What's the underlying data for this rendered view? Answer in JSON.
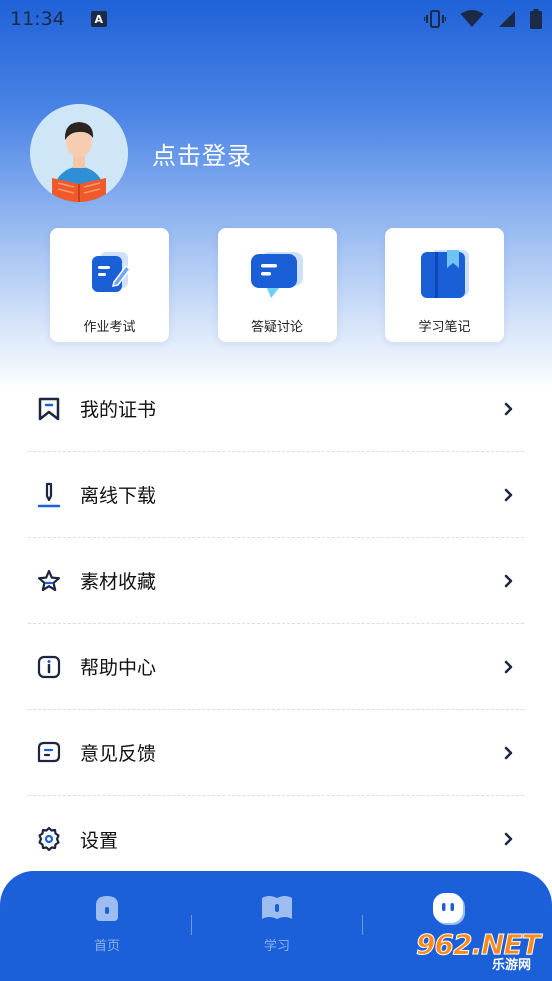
{
  "status_bar": {
    "time": "11:34",
    "notification_icon": "A"
  },
  "profile": {
    "login_text": "点击登录"
  },
  "quick_actions": [
    {
      "label": "作业考试",
      "icon": "homework-exam-icon"
    },
    {
      "label": "答疑讨论",
      "icon": "qa-discussion-icon"
    },
    {
      "label": "学习笔记",
      "icon": "study-notes-icon"
    }
  ],
  "menu": [
    {
      "label": "我的证书",
      "icon": "bookmark-icon"
    },
    {
      "label": "离线下载",
      "icon": "download-pen-icon"
    },
    {
      "label": "素材收藏",
      "icon": "star-icon"
    },
    {
      "label": "帮助中心",
      "icon": "info-icon"
    },
    {
      "label": "意见反馈",
      "icon": "feedback-icon"
    },
    {
      "label": "设置",
      "icon": "gear-icon"
    }
  ],
  "bottom_nav": [
    {
      "label": "首页"
    },
    {
      "label": "学习"
    },
    {
      "label": ""
    }
  ],
  "watermark": {
    "main": "962.NET",
    "sub": "乐游网"
  },
  "colors": {
    "primary": "#1b5fd9",
    "accent": "#ff8a1c"
  }
}
